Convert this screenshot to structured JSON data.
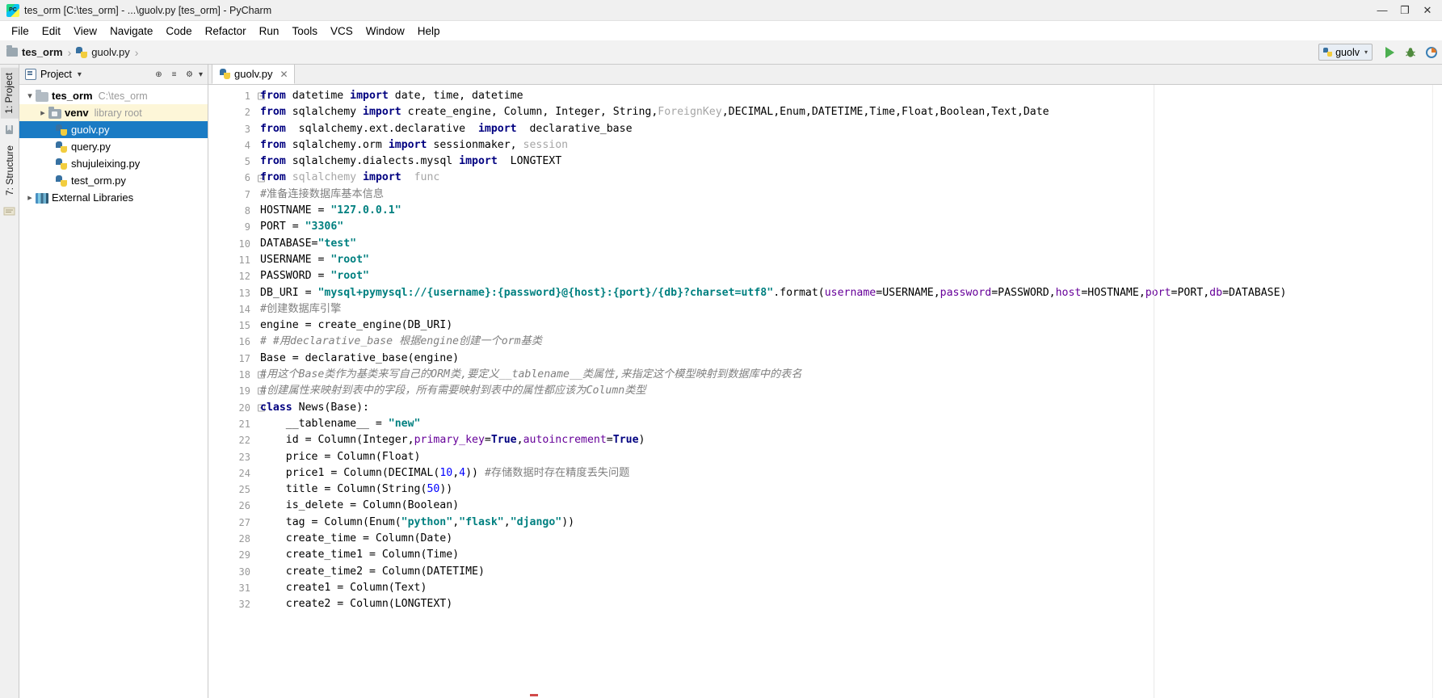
{
  "window": {
    "title": "tes_orm [C:\\tes_orm] - ...\\guolv.py [tes_orm] - PyCharm",
    "app_icon": "pycharm-icon",
    "minimize": "—",
    "maximize": "❐",
    "close": "✕"
  },
  "menubar": {
    "items": [
      {
        "label": "File"
      },
      {
        "label": "Edit"
      },
      {
        "label": "View"
      },
      {
        "label": "Navigate"
      },
      {
        "label": "Code"
      },
      {
        "label": "Refactor"
      },
      {
        "label": "Run"
      },
      {
        "label": "Tools"
      },
      {
        "label": "VCS"
      },
      {
        "label": "Window"
      },
      {
        "label": "Help"
      }
    ]
  },
  "navbar": {
    "breadcrumb": [
      {
        "label": "tes_orm",
        "icon": "folder-icon"
      },
      {
        "label": "guolv.py",
        "icon": "python-file-icon"
      }
    ],
    "separator": "›",
    "run_config": {
      "label": "guolv",
      "caret": "▾"
    },
    "buttons": [
      {
        "name": "run-button",
        "glyph": "▶"
      },
      {
        "name": "debug-button",
        "glyph": "ὁE"
      },
      {
        "name": "coverage-button",
        "glyph": "⚙"
      }
    ]
  },
  "leftstrip": {
    "project_tab": "1: Project",
    "structure_tab": "7: Structure",
    "favorites_icon": "favorites-icon",
    "todo_icon": "todo-icon"
  },
  "project_panel": {
    "header": {
      "title": "Project",
      "caret": "▾",
      "locate_icon": "⊕",
      "collapse_icon": "≡",
      "settings_icon": "⚙",
      "settings_caret": "▾"
    },
    "tree": [
      {
        "label": "tes_orm",
        "meta": "C:\\tes_orm",
        "icon": "folder-icon",
        "arrow": "down",
        "indent": 0,
        "bold": true,
        "state": "normal"
      },
      {
        "label": "venv",
        "meta": "library root",
        "icon": "venv-folder-icon",
        "arrow": "right",
        "indent": 1,
        "bold": true,
        "state": "highlight"
      },
      {
        "label": "guolv.py",
        "meta": "",
        "icon": "python-file-icon",
        "arrow": "none",
        "indent": 2,
        "bold": false,
        "state": "selected"
      },
      {
        "label": "query.py",
        "meta": "",
        "icon": "python-file-icon",
        "arrow": "none",
        "indent": 2,
        "bold": false,
        "state": "normal"
      },
      {
        "label": "shujuleixing.py",
        "meta": "",
        "icon": "python-file-icon",
        "arrow": "none",
        "indent": 2,
        "bold": false,
        "state": "normal"
      },
      {
        "label": "test_orm.py",
        "meta": "",
        "icon": "python-file-icon",
        "arrow": "none",
        "indent": 2,
        "bold": false,
        "state": "normal"
      },
      {
        "label": "External Libraries",
        "meta": "",
        "icon": "library-icon",
        "arrow": "right",
        "indent": 0,
        "bold": false,
        "state": "normal"
      }
    ]
  },
  "editor": {
    "tabs": [
      {
        "label": "guolv.py",
        "icon": "python-file-icon",
        "close": "✕",
        "active": true
      }
    ],
    "lines": [
      {
        "n": 1,
        "fold": "minus"
      },
      {
        "n": 2,
        "fold": "none"
      },
      {
        "n": 3,
        "fold": "none"
      },
      {
        "n": 4,
        "fold": "none"
      },
      {
        "n": 5,
        "fold": "none"
      },
      {
        "n": 6,
        "fold": "minus"
      },
      {
        "n": 7,
        "fold": "none"
      },
      {
        "n": 8,
        "fold": "none"
      },
      {
        "n": 9,
        "fold": "none"
      },
      {
        "n": 10,
        "fold": "none"
      },
      {
        "n": 11,
        "fold": "none"
      },
      {
        "n": 12,
        "fold": "none"
      },
      {
        "n": 13,
        "fold": "none"
      },
      {
        "n": 14,
        "fold": "none"
      },
      {
        "n": 15,
        "fold": "none"
      },
      {
        "n": 16,
        "fold": "none"
      },
      {
        "n": 17,
        "fold": "none"
      },
      {
        "n": 18,
        "fold": "minus"
      },
      {
        "n": 19,
        "fold": "minus"
      },
      {
        "n": 20,
        "fold": "minus"
      },
      {
        "n": 21,
        "fold": "none"
      },
      {
        "n": 22,
        "fold": "none"
      },
      {
        "n": 23,
        "fold": "none"
      },
      {
        "n": 24,
        "fold": "none"
      },
      {
        "n": 25,
        "fold": "none"
      },
      {
        "n": 26,
        "fold": "none"
      },
      {
        "n": 27,
        "fold": "none"
      },
      {
        "n": 28,
        "fold": "none"
      },
      {
        "n": 29,
        "fold": "none"
      },
      {
        "n": 30,
        "fold": "none"
      },
      {
        "n": 31,
        "fold": "none"
      },
      {
        "n": 32,
        "fold": "none"
      }
    ],
    "code_text": [
      "from datetime import date, time, datetime",
      "from sqlalchemy import create_engine, Column, Integer, String,ForeignKey,DECIMAL,Enum,DATETIME,Time,Float,Boolean,Text,Date",
      "from  sqlalchemy.ext.declarative  import  declarative_base",
      "from sqlalchemy.orm import sessionmaker, session",
      "from sqlalchemy.dialects.mysql import  LONGTEXT",
      "from sqlalchemy import  func",
      "#准备连接数据库基本信息",
      "HOSTNAME = \"127.0.0.1\"",
      "PORT = \"3306\"",
      "DATABASE=\"test\"",
      "USERNAME = \"root\"",
      "PASSWORD = \"root\"",
      "DB_URI = \"mysql+pymysql://{username}:{password}@{host}:{port}/{db}?charset=utf8\".format(username=USERNAME,password=PASSWORD,host=HOSTNAME,port=PORT,db=DATABASE)",
      "#创建数据库引擎",
      "engine = create_engine(DB_URI)",
      "# #用declarative_base 根据engine创建一个orm基类",
      "Base = declarative_base(engine)",
      "#用这个Base类作为基类来写自己的ORM类,要定义__tablename__类属性,来指定这个模型映射到数据库中的表名",
      "#创建属性来映射到表中的字段，所有需要映射到表中的属性都应该为Column类型",
      "class News(Base):",
      "    __tablename__ = \"new\"",
      "    id = Column(Integer,primary_key=True,autoincrement=True)",
      "    price = Column(Float)",
      "    price1 = Column(DECIMAL(10,4)) #存储数据时存在精度丢失问题",
      "    title = Column(String(50))",
      "    is_delete = Column(Boolean)",
      "    tag = Column(Enum(\"python\",\"flask\",\"django\"))",
      "    create_time = Column(Date)",
      "    create_time1 = Column(Time)",
      "    create_time2 = Column(DATETIME)",
      "    create1 = Column(Text)",
      "    create2 = Column(LONGTEXT)"
    ]
  },
  "colors": {
    "selection_blue": "#1a7bc4",
    "highlight_yellow": "#fdf6d8",
    "keyword": "#000080",
    "string": "#008080",
    "number": "#0000ff",
    "comment": "#808080",
    "param": "#660099",
    "unused_gray": "#a6a6a6",
    "run_green": "#4caf50"
  }
}
